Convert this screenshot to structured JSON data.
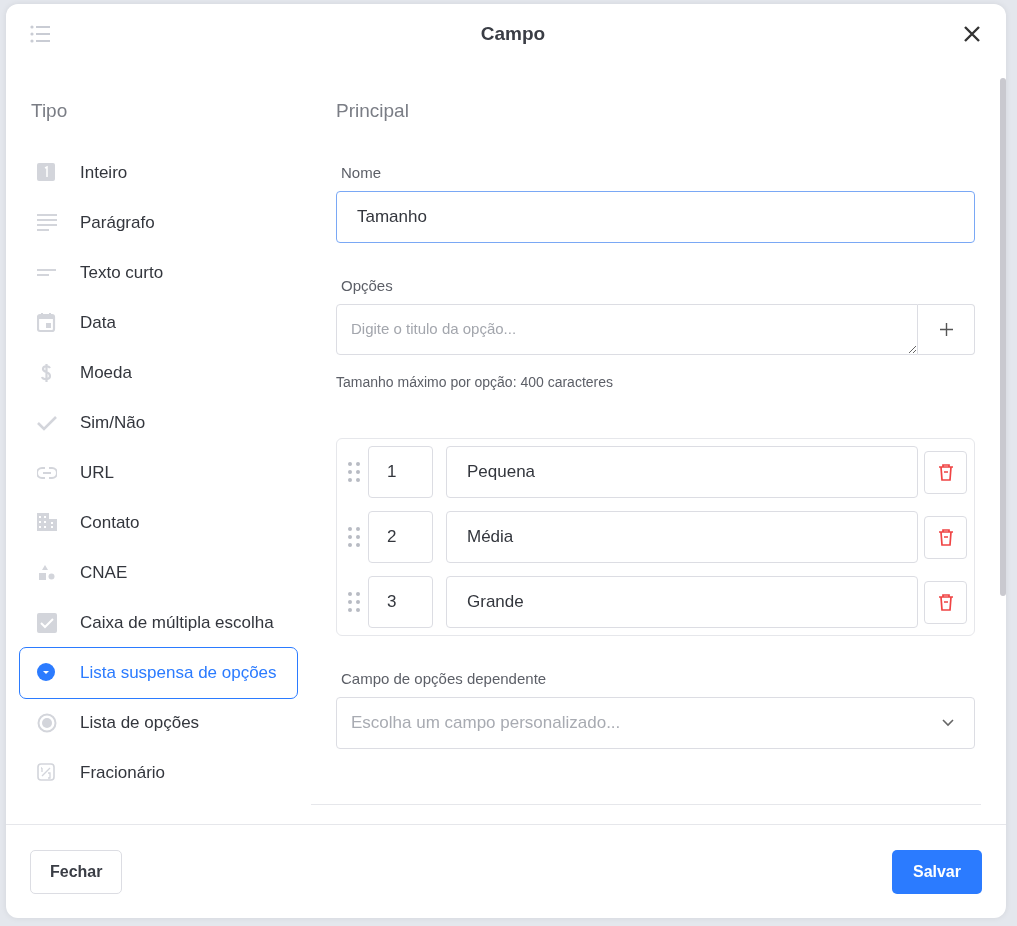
{
  "dialog": {
    "title": "Campo"
  },
  "type_panel": {
    "heading": "Tipo",
    "items": [
      {
        "label": "Inteiro",
        "kind": "integer",
        "selected": false
      },
      {
        "label": "Parágrafo",
        "kind": "paragraph",
        "selected": false
      },
      {
        "label": "Texto curto",
        "kind": "short",
        "selected": false
      },
      {
        "label": "Data",
        "kind": "date",
        "selected": false
      },
      {
        "label": "Moeda",
        "kind": "currency",
        "selected": false
      },
      {
        "label": "Sim/Não",
        "kind": "check",
        "selected": false
      },
      {
        "label": "URL",
        "kind": "link",
        "selected": false
      },
      {
        "label": "Contato",
        "kind": "building",
        "selected": false
      },
      {
        "label": "CNAE",
        "kind": "shapes",
        "selected": false
      },
      {
        "label": "Caixa de múltipla escolha",
        "kind": "checkbox",
        "selected": false
      },
      {
        "label": "Lista suspensa de opções",
        "kind": "dropdown",
        "selected": true
      },
      {
        "label": "Lista de opções",
        "kind": "radio",
        "selected": false
      },
      {
        "label": "Fracionário",
        "kind": "fraction",
        "selected": false
      }
    ]
  },
  "main": {
    "heading": "Principal",
    "name_field": {
      "label": "Nome",
      "value": "Tamanho",
      "focused": true
    },
    "options_field": {
      "label": "Opções",
      "placeholder": "Digite o titulo da opção...",
      "hint": "Tamanho máximo por opção: 400 caracteres"
    },
    "options": [
      {
        "order": "1",
        "title": "Pequena"
      },
      {
        "order": "2",
        "title": "Média"
      },
      {
        "order": "3",
        "title": "Grande"
      }
    ],
    "dependent_field": {
      "label": "Campo de opções dependente",
      "placeholder": "Escolha um campo personalizado..."
    }
  },
  "footer": {
    "buttons": [
      {
        "label": "Fechar",
        "kind": "secondary"
      },
      {
        "label": "Salvar",
        "kind": "primary"
      }
    ]
  }
}
